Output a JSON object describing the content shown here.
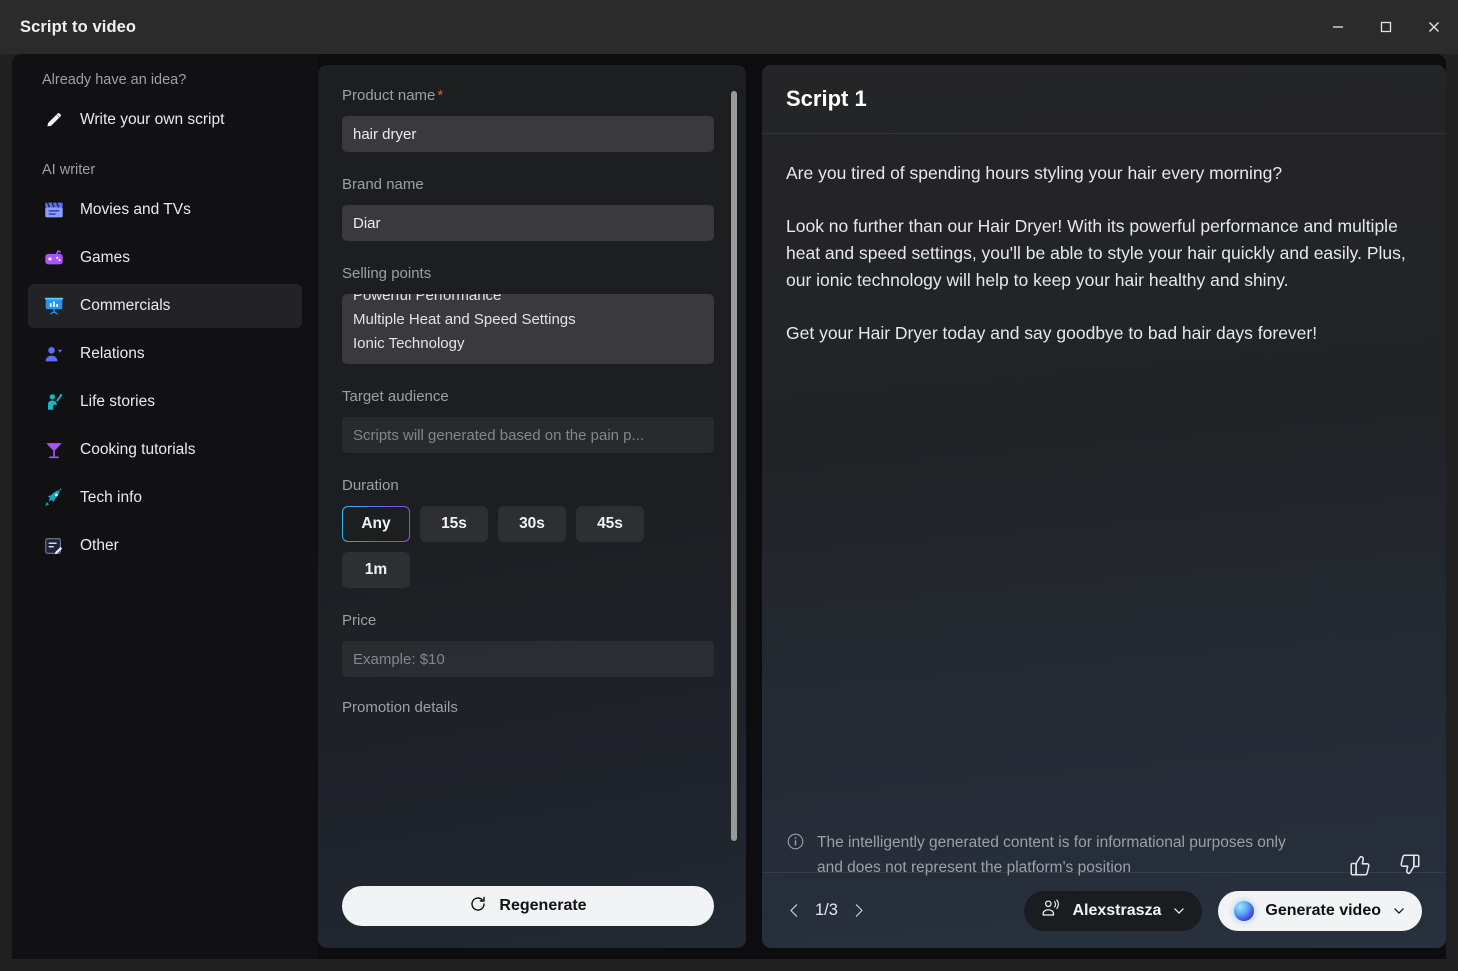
{
  "window": {
    "title": "Script to video",
    "minimize_label": "–",
    "maximize_label": "□",
    "close_label": "✕"
  },
  "sidebar": {
    "section_idea": "Already have an idea?",
    "section_ai": "AI writer",
    "write_own": {
      "label": "Write your own script",
      "icon": "pencil-icon"
    },
    "items": [
      {
        "label": "Movies and TVs",
        "icon": "clapperboard-icon",
        "active": false
      },
      {
        "label": "Games",
        "icon": "gamepad-icon",
        "active": false
      },
      {
        "label": "Commercials",
        "icon": "presentation-icon",
        "active": true
      },
      {
        "label": "Relations",
        "icon": "people-icon",
        "active": false
      },
      {
        "label": "Life stories",
        "icon": "person-wave-icon",
        "active": false
      },
      {
        "label": "Cooking tutorials",
        "icon": "cocktail-icon",
        "active": false
      },
      {
        "label": "Tech info",
        "icon": "rocket-icon",
        "active": false
      },
      {
        "label": "Other",
        "icon": "note-edit-icon",
        "active": false
      }
    ]
  },
  "form": {
    "product_name": {
      "label": "Product name",
      "required_mark": "*",
      "value": "hair dryer"
    },
    "brand_name": {
      "label": "Brand name",
      "value": "Diar"
    },
    "selling_points": {
      "label": "Selling points",
      "lines": [
        "Powerful Performance",
        "Multiple Heat and Speed Settings",
        "Ionic Technology"
      ]
    },
    "target_audience": {
      "label": "Target audience",
      "value": "",
      "placeholder": "Scripts will generated based on the pain p..."
    },
    "duration": {
      "label": "Duration",
      "options": [
        "Any",
        "15s",
        "30s",
        "45s",
        "1m"
      ],
      "selected": "Any"
    },
    "price": {
      "label": "Price",
      "value": "",
      "placeholder": "Example: $10"
    },
    "promotion_details": {
      "label": "Promotion details"
    },
    "regenerate": {
      "label": "Regenerate",
      "icon": "refresh-icon"
    }
  },
  "script": {
    "title": "Script 1",
    "paragraphs": [
      "Are you tired of spending hours styling your hair every morning?",
      "Look no further than our Hair Dryer! With its powerful performance and multiple heat and speed settings, you'll be able to style your hair quickly and easily. Plus, our ionic technology will help to keep your hair healthy and shiny.",
      "Get your Hair Dryer today and say goodbye to bad hair days forever!"
    ],
    "disclaimer": "The intelligently generated content is for informational purposes only and does not represent the platform's position",
    "feedback": {
      "like": "thumbs-up-icon",
      "dislike": "thumbs-down-icon"
    },
    "pagination": {
      "prev": "chevron-left-icon",
      "count": "1/3",
      "next": "chevron-right-icon"
    },
    "voice": {
      "label": "Alexstrasza",
      "icon": "voice-person-icon",
      "chevron": "chevron-down-icon"
    },
    "generate": {
      "label": "Generate video",
      "icon": "ai-orb-icon",
      "chevron": "chevron-down-icon"
    }
  },
  "colors": {
    "accent_gradient_start": "#2ec8ef",
    "accent_gradient_end": "#8a4df0",
    "required_star": "#e05d48",
    "panel_bg": "#1d1e20",
    "sidebar_bg": "#111113"
  }
}
